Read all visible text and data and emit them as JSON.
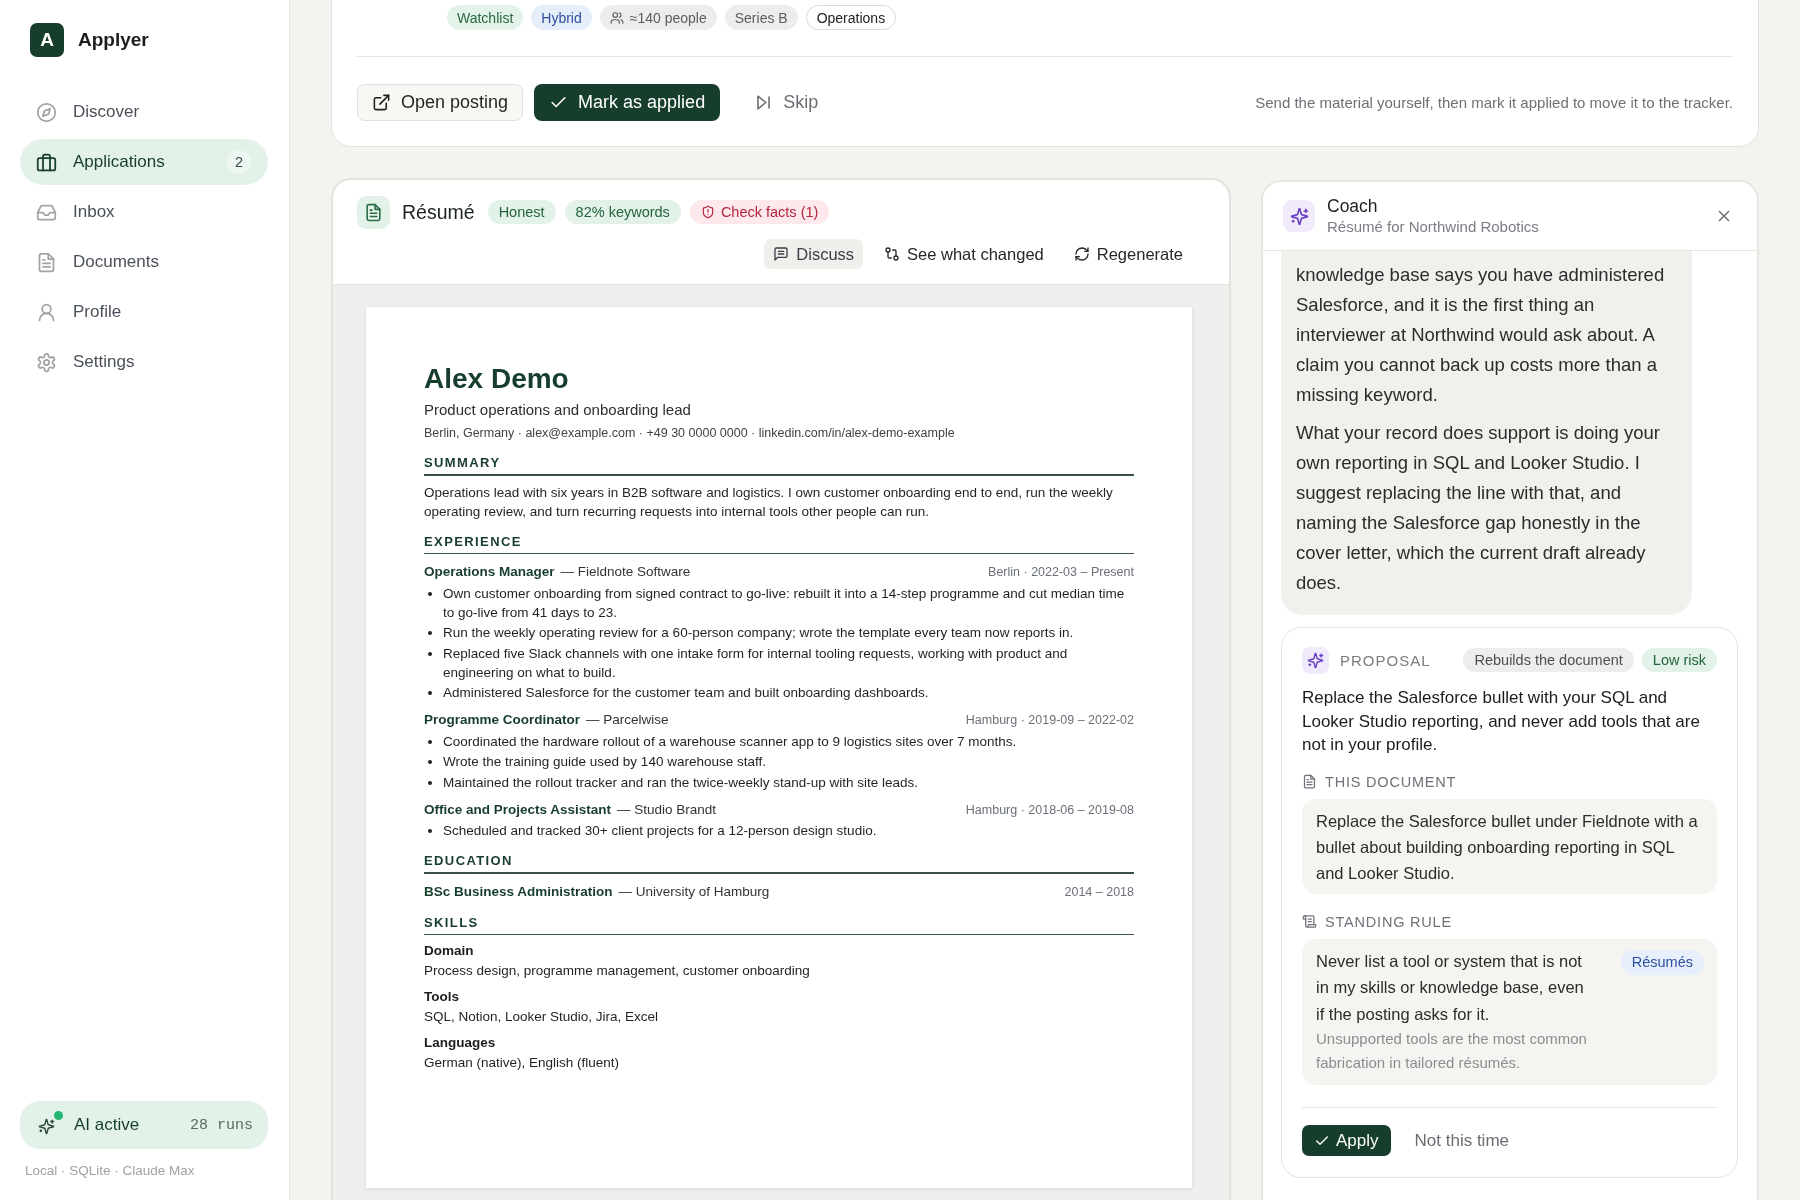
{
  "sidebar": {
    "brand": {
      "logo": "A",
      "name": "Applyer"
    },
    "nav_items": [
      {
        "label": "Discover",
        "selected": false
      },
      {
        "label": "Applications",
        "selected": true,
        "count": "2"
      },
      {
        "label": "Inbox",
        "selected": false
      },
      {
        "label": "Documents",
        "selected": false
      },
      {
        "label": "Profile",
        "selected": false
      },
      {
        "label": "Settings",
        "selected": false
      }
    ],
    "ai_status": {
      "label": "AI active",
      "runs": "28 runs",
      "active": true
    },
    "footer": "Local · SQLite · Claude Max"
  },
  "posting": {
    "tags": [
      {
        "label": "Watchlist",
        "kind": "status"
      },
      {
        "label": "Hybrid",
        "kind": "mode"
      },
      {
        "label": "≈140 people",
        "kind": "size"
      },
      {
        "label": "Series B",
        "kind": "stage"
      },
      {
        "label": "Operations",
        "kind": "team"
      }
    ],
    "actions": [
      {
        "label": "Open posting",
        "kind": "secondary"
      },
      {
        "label": "Mark as applied",
        "kind": "primary"
      },
      {
        "label": "Skip",
        "kind": "ghost"
      }
    ],
    "hint": "Send the material yourself, then mark it applied to move it to the tracker."
  },
  "resume": {
    "title": "Résumé",
    "badges": [
      {
        "label": "Honest",
        "kind": "ok"
      },
      {
        "label": "82% keywords",
        "kind": "ok"
      },
      {
        "label": "Check facts (1)",
        "kind": "warning"
      }
    ],
    "tools": [
      {
        "label": "Discuss",
        "selected": true
      },
      {
        "label": "See what changed",
        "selected": false
      },
      {
        "label": "Regenerate",
        "selected": false
      }
    ],
    "document": {
      "name": "Alex Demo",
      "headline": "Product operations and onboarding lead",
      "contact": "Berlin, Germany · alex@example.com · +49 30 0000 0000 · linkedin.com/in/alex-demo-example",
      "sections": [
        {
          "heading": "SUMMARY",
          "kind": "text",
          "text": "Operations lead with six years in B2B software and logistics. I own customer onboarding end to end, run the weekly operating review, and turn recurring requests into internal tools other people can run."
        },
        {
          "heading": "EXPERIENCE",
          "kind": "entries",
          "entries": [
            {
              "title": "Operations Manager",
              "org": "— Fieldnote Software",
              "meta": "Berlin · 2022-03 – Present",
              "bullets": [
                "Own customer onboarding from signed contract to go-live: rebuilt it into a 14-step programme and cut median time to go-live from 41 days to 23.",
                "Run the weekly operating review for a 60-person company; wrote the template every team now reports in.",
                "Replaced five Slack channels with one intake form for internal tooling requests, working with product and engineering on what to build.",
                "Administered Salesforce for the customer team and built onboarding dashboards."
              ]
            },
            {
              "title": "Programme Coordinator",
              "org": "— Parcelwise",
              "meta": "Hamburg · 2019-09 – 2022-02",
              "bullets": [
                "Coordinated the hardware rollout of a warehouse scanner app to 9 logistics sites over 7 months.",
                "Wrote the training guide used by 140 warehouse staff.",
                "Maintained the rollout tracker and ran the twice-weekly stand-up with site leads."
              ]
            },
            {
              "title": "Office and Projects Assistant",
              "org": "— Studio Brandt",
              "meta": "Hamburg · 2018-06 – 2019-08",
              "bullets": [
                "Scheduled and tracked 30+ client projects for a 12-person design studio."
              ]
            }
          ]
        },
        {
          "heading": "EDUCATION",
          "kind": "entries",
          "entries": [
            {
              "title": "BSc Business Administration",
              "org": "— University of Hamburg",
              "meta": "2014 – 2018"
            }
          ]
        },
        {
          "heading": "SKILLS",
          "kind": "groups",
          "groups": [
            {
              "label": "Domain",
              "text": "Process design, programme management, customer onboarding"
            },
            {
              "label": "Tools",
              "text": "SQL, Notion, Looker Studio, Jira, Excel"
            },
            {
              "label": "Languages",
              "text": "German (native), English (fluent)"
            }
          ]
        }
      ]
    }
  },
  "coach": {
    "title": "Coach",
    "subtitle": "Résumé for Northwind Robotics",
    "message": {
      "paragraphs": [
        "knowledge base says you have administered Salesforce, and it is the first thing an interviewer at Northwind would ask about. A claim you cannot back up costs more than a missing keyword.",
        "What your record does support is doing your own reporting in SQL and Looker Studio. I suggest replacing the line with that, and naming the Salesforce gap honestly in the cover letter, which the current draft already does."
      ]
    },
    "proposal": {
      "label": "PROPOSAL",
      "badges": [
        {
          "label": "Rebuilds the document",
          "kind": "scope"
        },
        {
          "label": "Low risk",
          "kind": "risk"
        }
      ],
      "summary": "Replace the Salesforce bullet with your SQL and Looker Studio reporting, and never add tools that are not in your profile.",
      "changes": [
        {
          "kind": "document",
          "heading": "THIS DOCUMENT",
          "text": "Replace the Salesforce bullet under Fieldnote with a bullet about building onboarding reporting in SQL and Looker Studio."
        },
        {
          "kind": "rule",
          "heading": "STANDING RULE",
          "text": "Never list a tool or system that is not in my skills or knowledge base, even if the posting asks for it.",
          "scope": "Résumés",
          "note": "Unsupported tools are the most common fabrication in tailored résumés."
        }
      ],
      "actions": [
        {
          "label": "Apply",
          "kind": "primary"
        },
        {
          "label": "Not this time",
          "kind": "ghost"
        }
      ]
    }
  }
}
